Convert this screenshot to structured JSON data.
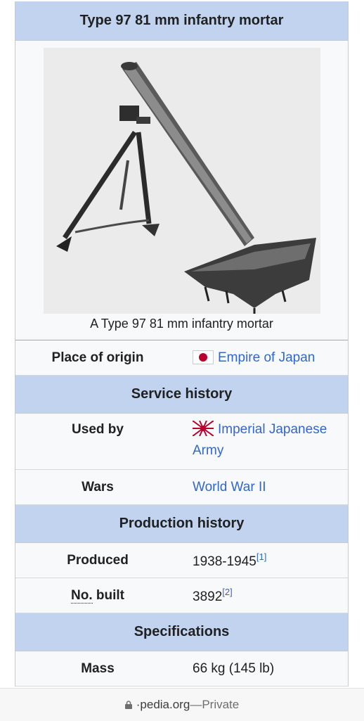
{
  "infobox": {
    "title": "Type 97 81 mm infantry mortar",
    "caption": "A Type 97 81 mm infantry mortar",
    "place_of_origin": {
      "label": "Place of origin",
      "value": "Empire of Japan",
      "flag": "japan-flag-icon"
    },
    "service_history": {
      "heading": "Service history",
      "used_by": {
        "label": "Used by",
        "value_line1": "Imperial Japanese",
        "value_line2": "Army",
        "flag": "rising-sun-flag-icon"
      },
      "wars": {
        "label": "Wars",
        "value": "World War II"
      }
    },
    "production_history": {
      "heading": "Production history",
      "produced": {
        "label": "Produced",
        "value": "1938-1945",
        "ref": "[1]"
      },
      "no_built": {
        "label_abbr": "No.",
        "label_rest": " built",
        "value": "3892",
        "ref": "[2]"
      }
    },
    "specifications": {
      "heading": "Specifications",
      "mass": {
        "label": "Mass",
        "value": "66 kg (145 lb)"
      }
    }
  },
  "browser": {
    "url_text": "·pedia.org",
    "separator": " — ",
    "mode": "Private",
    "icon": "lock-icon"
  },
  "colors": {
    "section_bg": "#c1d3ef",
    "link": "#3366cc",
    "box_bg": "#f8f9fa"
  }
}
